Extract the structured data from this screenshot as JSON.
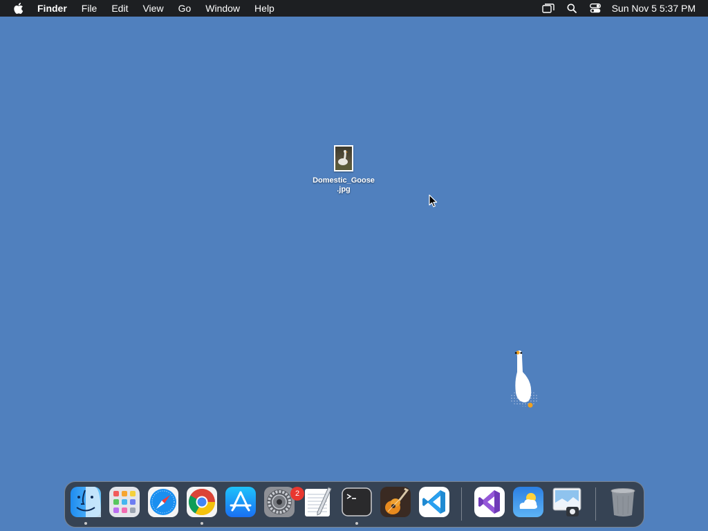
{
  "menubar": {
    "app_name": "Finder",
    "items": [
      "File",
      "Edit",
      "View",
      "Go",
      "Window",
      "Help"
    ],
    "clock": "Sun Nov 5  5:37 PM"
  },
  "desktop": {
    "file": {
      "name_line1": "Domestic_Goose",
      "name_line2": ".jpg"
    }
  },
  "dock": {
    "apps": [
      {
        "name": "finder-icon",
        "running": true
      },
      {
        "name": "launchpad-icon",
        "running": false
      },
      {
        "name": "safari-icon",
        "running": false
      },
      {
        "name": "chrome-icon",
        "running": true
      },
      {
        "name": "app-store-icon",
        "running": false
      },
      {
        "name": "system-settings-icon",
        "running": false,
        "badge": "2"
      },
      {
        "name": "textedit-icon",
        "running": false
      },
      {
        "name": "terminal-icon",
        "running": true
      },
      {
        "name": "garageband-icon",
        "running": false
      },
      {
        "name": "vscode-icon",
        "running": false
      },
      {
        "name": "visual-studio-icon",
        "running": false
      },
      {
        "name": "weather-icon",
        "running": false
      },
      {
        "name": "preview-icon",
        "running": false
      },
      {
        "name": "trash-icon",
        "running": false
      }
    ]
  },
  "colors": {
    "desktop": "#5080BE",
    "menubar": "#1d1f22",
    "badge": "#e8372f"
  }
}
